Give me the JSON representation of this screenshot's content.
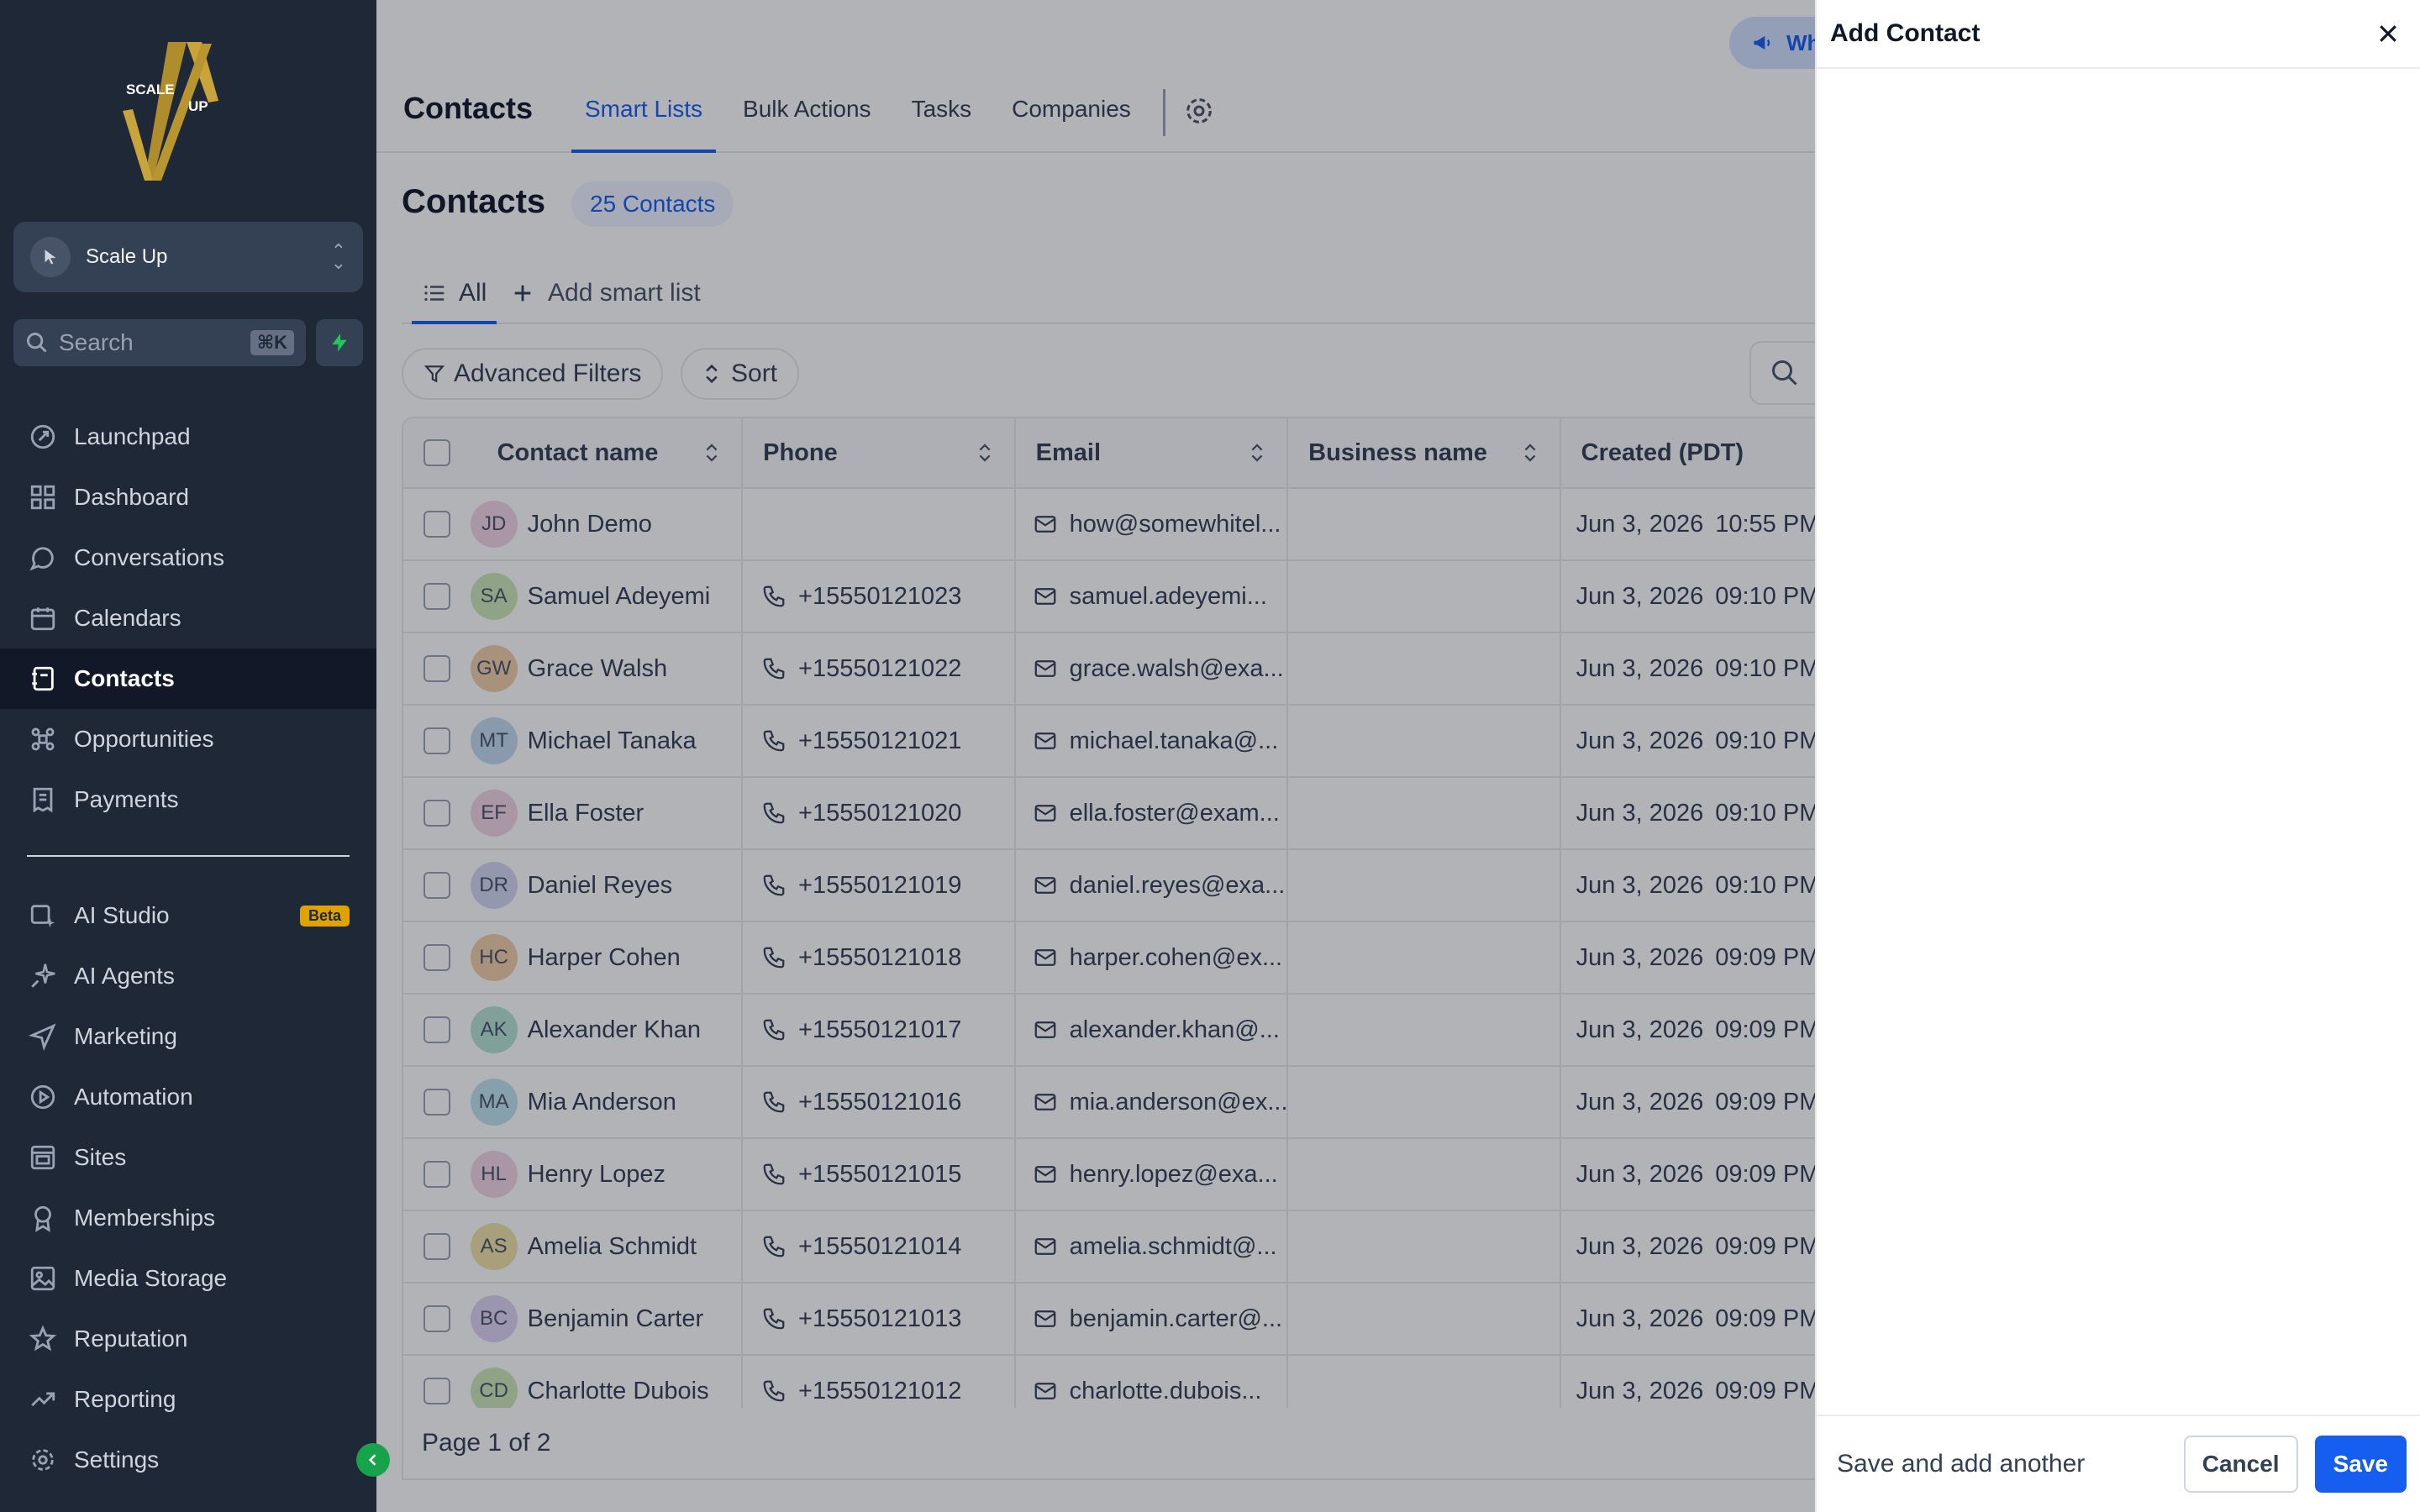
{
  "app": {
    "logo_text": [
      "SCALE",
      "UP"
    ],
    "account_name": "Scale Up",
    "search_placeholder": "Search",
    "search_shortcut": "⌘K"
  },
  "sidebar": {
    "items": [
      {
        "label": "Launchpad",
        "icon": "rocket-icon"
      },
      {
        "label": "Dashboard",
        "icon": "grid-icon"
      },
      {
        "label": "Conversations",
        "icon": "chat-icon"
      },
      {
        "label": "Calendars",
        "icon": "calendar-icon"
      },
      {
        "label": "Contacts",
        "icon": "contacts-book-icon",
        "active": true
      },
      {
        "label": "Opportunities",
        "icon": "funnel-icon"
      },
      {
        "label": "Payments",
        "icon": "receipt-icon"
      }
    ],
    "items2": [
      {
        "label": "AI Studio",
        "icon": "ai-studio-icon",
        "badge": "Beta"
      },
      {
        "label": "AI Agents",
        "icon": "sparkle-icon"
      },
      {
        "label": "Marketing",
        "icon": "send-icon"
      },
      {
        "label": "Automation",
        "icon": "automation-icon"
      },
      {
        "label": "Sites",
        "icon": "sites-icon"
      },
      {
        "label": "Memberships",
        "icon": "badge-icon"
      },
      {
        "label": "Media Storage",
        "icon": "image-icon"
      },
      {
        "label": "Reputation",
        "icon": "star-icon"
      },
      {
        "label": "Reporting",
        "icon": "trend-icon"
      },
      {
        "label": "Settings",
        "icon": "gear-icon"
      }
    ]
  },
  "topbar": {
    "title": "Contacts",
    "tabs": [
      "Smart Lists",
      "Bulk Actions",
      "Tasks",
      "Companies"
    ],
    "active_tab": "Smart Lists",
    "whats_new": "Wh"
  },
  "content": {
    "title": "Contacts",
    "count": "25 Contacts",
    "list_all": "All",
    "add_smart_list": "Add smart list",
    "advanced_filters": "Advanced Filters",
    "sort": "Sort"
  },
  "table": {
    "columns": [
      "Contact name",
      "Phone",
      "Email",
      "Business name",
      "Created (PDT)"
    ],
    "rows": [
      {
        "initials": "JD",
        "name": "John Demo",
        "phone": "",
        "email": "how@somewhitel...",
        "business": "",
        "date": "Jun 3, 2026",
        "time": "10:55 PM",
        "avatar_color": "#f4d6e6"
      },
      {
        "initials": "SA",
        "name": "Samuel Adeyemi",
        "phone": "+15550121023",
        "email": "samuel.adeyemi...",
        "business": "",
        "date": "Jun 3, 2026",
        "time": "09:10 PM",
        "avatar_color": "#cfe8b8"
      },
      {
        "initials": "GW",
        "name": "Grace Walsh",
        "phone": "+15550121022",
        "email": "grace.walsh@exa...",
        "business": "",
        "date": "Jun 3, 2026",
        "time": "09:10 PM",
        "avatar_color": "#f2cfa9"
      },
      {
        "initials": "MT",
        "name": "Michael Tanaka",
        "phone": "+15550121021",
        "email": "michael.tanaka@...",
        "business": "",
        "date": "Jun 3, 2026",
        "time": "09:10 PM",
        "avatar_color": "#c4dbf0"
      },
      {
        "initials": "EF",
        "name": "Ella Foster",
        "phone": "+15550121020",
        "email": "ella.foster@exam...",
        "business": "",
        "date": "Jun 3, 2026",
        "time": "09:10 PM",
        "avatar_color": "#f4d6e6"
      },
      {
        "initials": "DR",
        "name": "Daniel Reyes",
        "phone": "+15550121019",
        "email": "daniel.reyes@exa...",
        "business": "",
        "date": "Jun 3, 2026",
        "time": "09:10 PM",
        "avatar_color": "#d1d8f3"
      },
      {
        "initials": "HC",
        "name": "Harper Cohen",
        "phone": "+15550121018",
        "email": "harper.cohen@ex...",
        "business": "",
        "date": "Jun 3, 2026",
        "time": "09:09 PM",
        "avatar_color": "#f2cfa9"
      },
      {
        "initials": "AK",
        "name": "Alexander Khan",
        "phone": "+15550121017",
        "email": "alexander.khan@...",
        "business": "",
        "date": "Jun 3, 2026",
        "time": "09:09 PM",
        "avatar_color": "#b7e4d3"
      },
      {
        "initials": "MA",
        "name": "Mia Anderson",
        "phone": "+15550121016",
        "email": "mia.anderson@ex...",
        "business": "",
        "date": "Jun 3, 2026",
        "time": "09:09 PM",
        "avatar_color": "#bfe3ef"
      },
      {
        "initials": "HL",
        "name": "Henry Lopez",
        "phone": "+15550121015",
        "email": "henry.lopez@exa...",
        "business": "",
        "date": "Jun 3, 2026",
        "time": "09:09 PM",
        "avatar_color": "#f4d6e6"
      },
      {
        "initials": "AS",
        "name": "Amelia Schmidt",
        "phone": "+15550121014",
        "email": "amelia.schmidt@...",
        "business": "",
        "date": "Jun 3, 2026",
        "time": "09:09 PM",
        "avatar_color": "#f1e3a6"
      },
      {
        "initials": "BC",
        "name": "Benjamin Carter",
        "phone": "+15550121013",
        "email": "benjamin.carter@...",
        "business": "",
        "date": "Jun 3, 2026",
        "time": "09:09 PM",
        "avatar_color": "#ddd3f3"
      },
      {
        "initials": "CD",
        "name": "Charlotte Dubois",
        "phone": "+15550121012",
        "email": "charlotte.dubois...",
        "business": "",
        "date": "Jun 3, 2026",
        "time": "09:09 PM",
        "avatar_color": "#cfe8b8"
      }
    ],
    "pagination": "Page 1 of 2"
  },
  "drawer": {
    "title": "Add Contact",
    "save_and_add": "Save and add another",
    "cancel": "Cancel",
    "save": "Save"
  },
  "colors": {
    "sidebar_bg": "#1e2837",
    "accent": "#155eef",
    "active_nav": "#111827"
  }
}
